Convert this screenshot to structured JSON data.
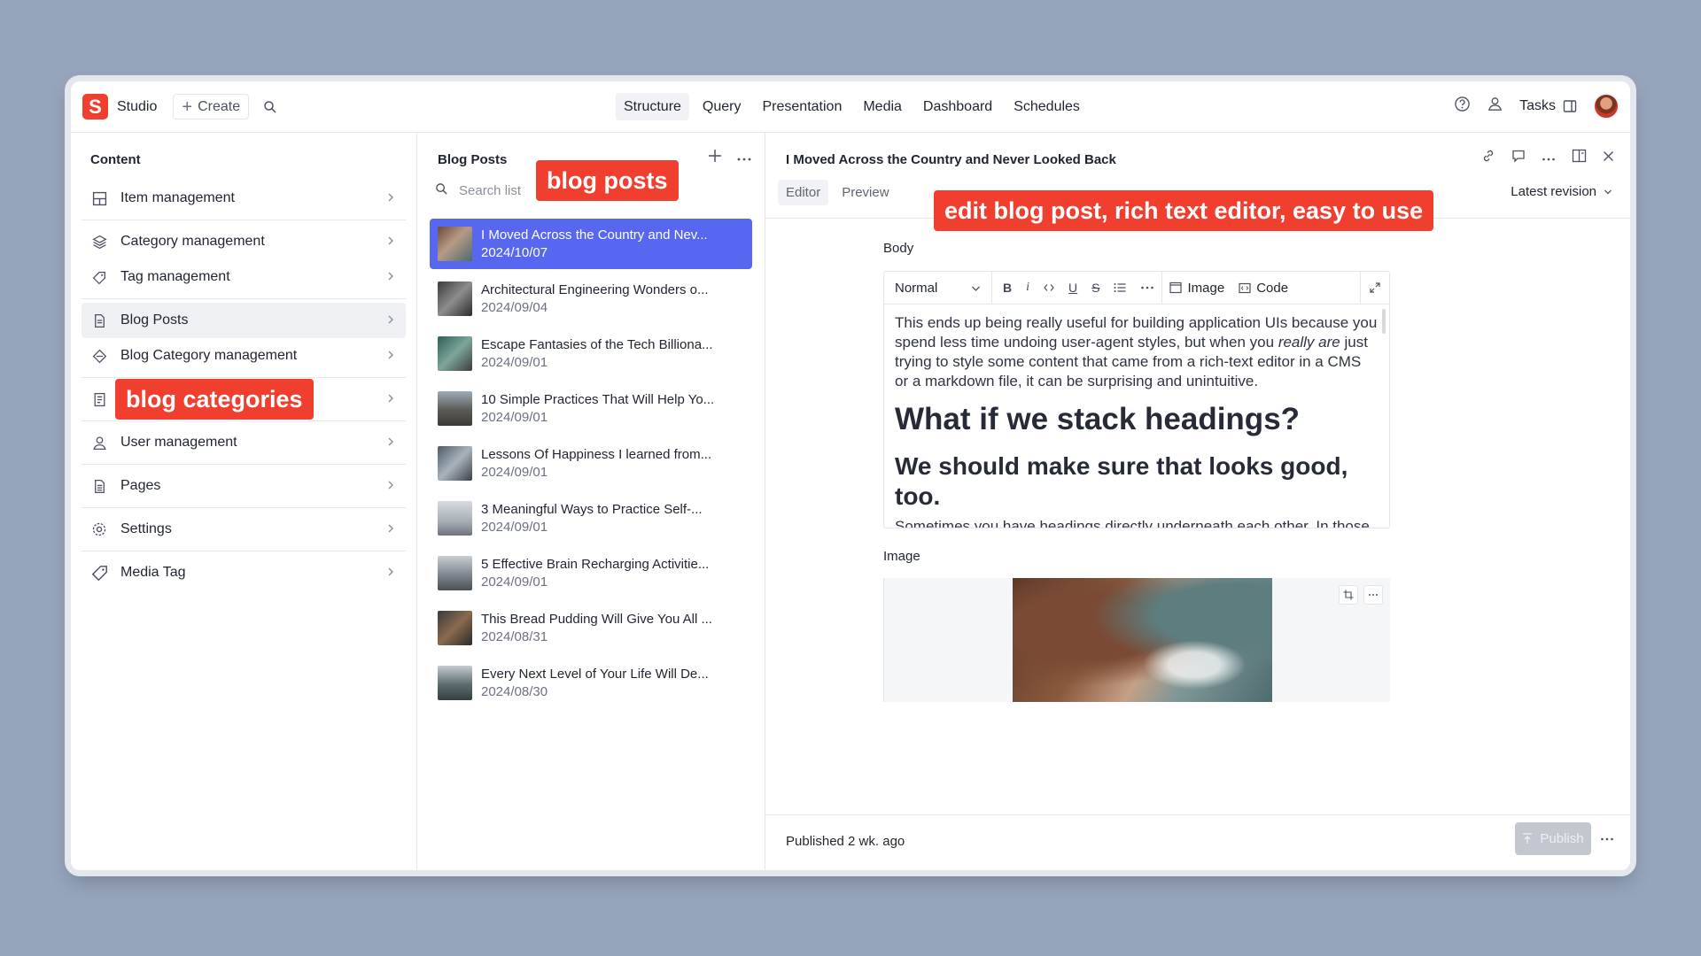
{
  "topbar": {
    "logo_letter": "S",
    "brand": "Studio",
    "create_label": "Create",
    "nav": [
      {
        "label": "Structure",
        "active": true
      },
      {
        "label": "Query"
      },
      {
        "label": "Presentation"
      },
      {
        "label": "Media"
      },
      {
        "label": "Dashboard"
      },
      {
        "label": "Schedules"
      }
    ],
    "tasks_label": "Tasks"
  },
  "content_pane": {
    "title": "Content",
    "items": [
      {
        "label": "Item management",
        "icon": "grid-icon"
      },
      {
        "label": "Category management",
        "icon": "layers-icon"
      },
      {
        "label": "Tag management",
        "icon": "tag-icon"
      },
      {
        "label": "Blog Posts",
        "icon": "document-icon",
        "active": true
      },
      {
        "label": "Blog Category management",
        "icon": "diamond-icon"
      },
      {
        "label": "",
        "icon": "blog-category-icon"
      },
      {
        "label": "User management",
        "icon": "users-icon"
      },
      {
        "label": "Pages",
        "icon": "page-icon"
      },
      {
        "label": "Settings",
        "icon": "gear-icon"
      },
      {
        "label": "Media Tag",
        "icon": "tag-icon"
      }
    ]
  },
  "blog_list": {
    "title": "Blog Posts",
    "search_placeholder": "Search list",
    "posts": [
      {
        "title": "I Moved Across the Country and Nev...",
        "date": "2024/10/07",
        "active": true
      },
      {
        "title": "Architectural Engineering Wonders o...",
        "date": "2024/09/04"
      },
      {
        "title": "Escape Fantasies of the Tech Billiona...",
        "date": "2024/09/01"
      },
      {
        "title": "10 Simple Practices That Will Help Yo...",
        "date": "2024/09/01"
      },
      {
        "title": "Lessons Of Happiness I learned from...",
        "date": "2024/09/01"
      },
      {
        "title": "3 Meaningful Ways to Practice Self-...",
        "date": "2024/09/01"
      },
      {
        "title": "5 Effective Brain Recharging Activitie...",
        "date": "2024/09/01"
      },
      {
        "title": "This Bread Pudding Will Give You All ...",
        "date": "2024/08/31"
      },
      {
        "title": "Every Next Level of Your Life Will De...",
        "date": "2024/08/30"
      }
    ]
  },
  "editor": {
    "doc_title": "I Moved Across the Country and Never Looked Back",
    "tabs": [
      {
        "label": "Editor",
        "active": true
      },
      {
        "label": "Preview"
      }
    ],
    "revision_label": "Latest revision",
    "body_label": "Body",
    "toolbar": {
      "style": "Normal",
      "bold": "B",
      "italic": "i",
      "image": "Image",
      "code": "Code"
    },
    "body": {
      "p1_a": "This ends up being really useful for building application UIs because you spend less time undoing user-agent styles, but when you ",
      "p1_em": "really are",
      "p1_b": " just trying to style some content that came from a rich-text editor in a CMS or a markdown file, it can be surprising and unintuitive.",
      "h1": "What if we stack headings?",
      "h2": "We should make sure that looks good, too.",
      "p2": "Sometimes you have headings directly underneath each other. In those cases you often have to undo the top margin on the second heading because it"
    },
    "image_label": "Image",
    "published": "Published 2 wk. ago",
    "publish_label": "Publish"
  },
  "annotations": {
    "blog_posts": "blog posts",
    "blog_categories": "blog categories",
    "editor": "edit blog post, rich text editor, easy to use"
  },
  "colors": {
    "brand": "#f03e2f",
    "selected_row": "#5867ef",
    "background": "#96a5bc"
  }
}
